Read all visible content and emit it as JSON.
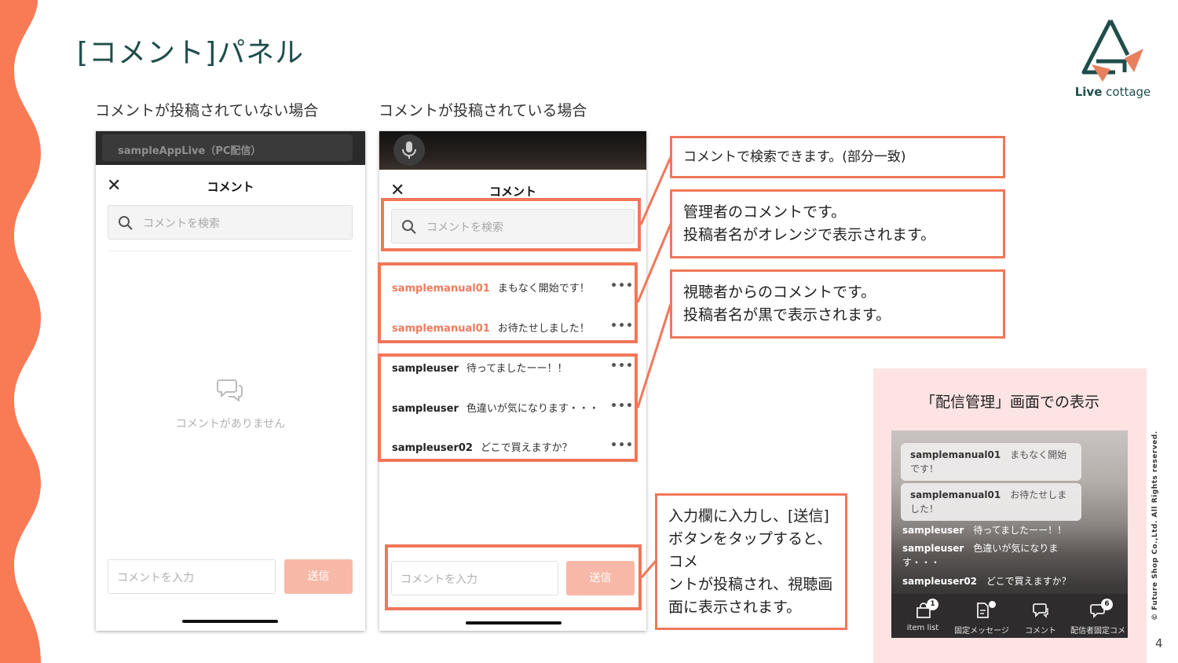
{
  "slide": {
    "title": "[コメント]パネル",
    "page_number": "4",
    "copyright": "© Future Shop Co.,Ltd. All Rights reserved.",
    "logo_text_bold": "Live",
    "logo_text": " cottage"
  },
  "colors": {
    "accent": "#f0775a",
    "wave": "#f97b55",
    "title": "#1f4e4a",
    "admin_name": "#f07a5e",
    "send_disabled": "#f8b8a8",
    "pink_panel": "#fde3e2"
  },
  "left_phone": {
    "label": "コメントが投稿されていない場合",
    "app_title": "sampleAppLive（PC配信）",
    "close": "✕",
    "panel_title": "コメント",
    "search_placeholder": "コメントを検索",
    "empty_text": "コメントがありません",
    "input_placeholder": "コメントを入力",
    "send_label": "送信"
  },
  "right_phone": {
    "label": "コメントが投稿されている場合",
    "close": "✕",
    "panel_title": "コメント",
    "search_placeholder": "コメントを検索",
    "comments": [
      {
        "name": "samplemanual01",
        "text": "まもなく開始です！",
        "more": "•••"
      },
      {
        "name": "samplemanual01",
        "text": "お待たせしました！",
        "more": "•••"
      },
      {
        "name": "sampleuser",
        "text": "待ってましたーー！！",
        "more": "•••"
      },
      {
        "name": "sampleuser",
        "text": "色違いが気になります・・・",
        "more": "•••"
      },
      {
        "name": "sampleuser02",
        "text": "どこで買えますか？",
        "more": "•••"
      }
    ],
    "input_placeholder": "コメントを入力",
    "send_label": "送信"
  },
  "callouts": {
    "search": "コメントで検索できます。(部分一致)",
    "admin_line1": "管理者のコメントです。",
    "admin_line2": "投稿者名がオレンジで表示されます。",
    "viewer_line1": "視聴者からのコメントです。",
    "viewer_line2": "投稿者名が黒で表示されます。",
    "send_line1": "入力欄に入力し、[送信]",
    "send_line2": "ボタンをタップすると、コメ",
    "send_line3": "ントが投稿され、視聴画",
    "send_line4": "面に表示されます。"
  },
  "distribution": {
    "title": "「配信管理」画面での表示",
    "bubbles": [
      {
        "name": "samplemanual01",
        "text": "まもなく開始",
        "text2": "です！"
      },
      {
        "name": "samplemanual01",
        "text": "お待たせしま",
        "text2": "した！"
      }
    ],
    "plain": [
      {
        "name": "sampleuser",
        "text": "待ってましたーー！！"
      },
      {
        "name": "sampleuser",
        "text": "色違いが気になりま",
        "text2": "す・・・"
      },
      {
        "name": "sampleuser02",
        "text": "どこで買えますか？"
      }
    ],
    "nav": [
      {
        "label": "item list",
        "badge": "1"
      },
      {
        "label": "固定メッセージ",
        "badge": ""
      },
      {
        "label": "コメント",
        "badge": ""
      },
      {
        "label": "配信者固定コメ",
        "badge": "6"
      }
    ]
  }
}
